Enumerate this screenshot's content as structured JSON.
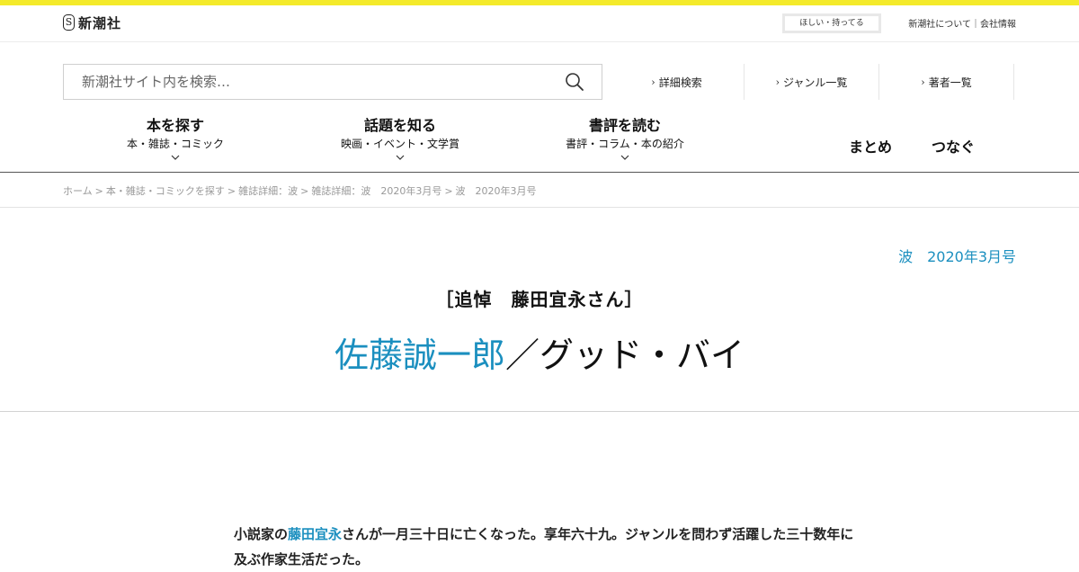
{
  "colors": {
    "accent_yellow": "#f4ea2a",
    "link_blue": "#1b8fbf"
  },
  "header": {
    "logo_mark": "S",
    "logo_text": "新潮社",
    "wish_button": "ほしい・持ってる",
    "about_link": "新潮社について｜会社情報"
  },
  "search": {
    "placeholder": "新潮社サイト内を検索…",
    "icon": "search-icon"
  },
  "quick_links": [
    {
      "label": "詳細検索"
    },
    {
      "label": "ジャンル一覧"
    },
    {
      "label": "著者一覧"
    }
  ],
  "nav": [
    {
      "label": "本を探す",
      "sub": "本・雑誌・コミック"
    },
    {
      "label": "話題を知る",
      "sub": "映画・イベント・文学賞"
    },
    {
      "label": "書評を読む",
      "sub": "書評・コラム・本の紹介"
    }
  ],
  "nav_single": [
    "まとめ",
    "つなぐ"
  ],
  "breadcrumb": [
    "ホーム",
    "本・雑誌・コミックを探す",
    "雑誌詳細：波",
    "雑誌詳細：波　2020年3月号",
    "波　2020年3月号"
  ],
  "breadcrumb_sep": ">",
  "article": {
    "issue": "波　2020年3月号",
    "category": "［追悼　藤田宜永さん］",
    "author": "佐藤誠一郎",
    "title_rest": "／グッド・バイ",
    "body_link": "藤田宜永",
    "body_pre": "小説家の",
    "body_post": "さんが一月三十日に亡くなった。享年六十九。ジャンルを問わず活躍した三十数年に及ぶ作家生活だった。"
  }
}
